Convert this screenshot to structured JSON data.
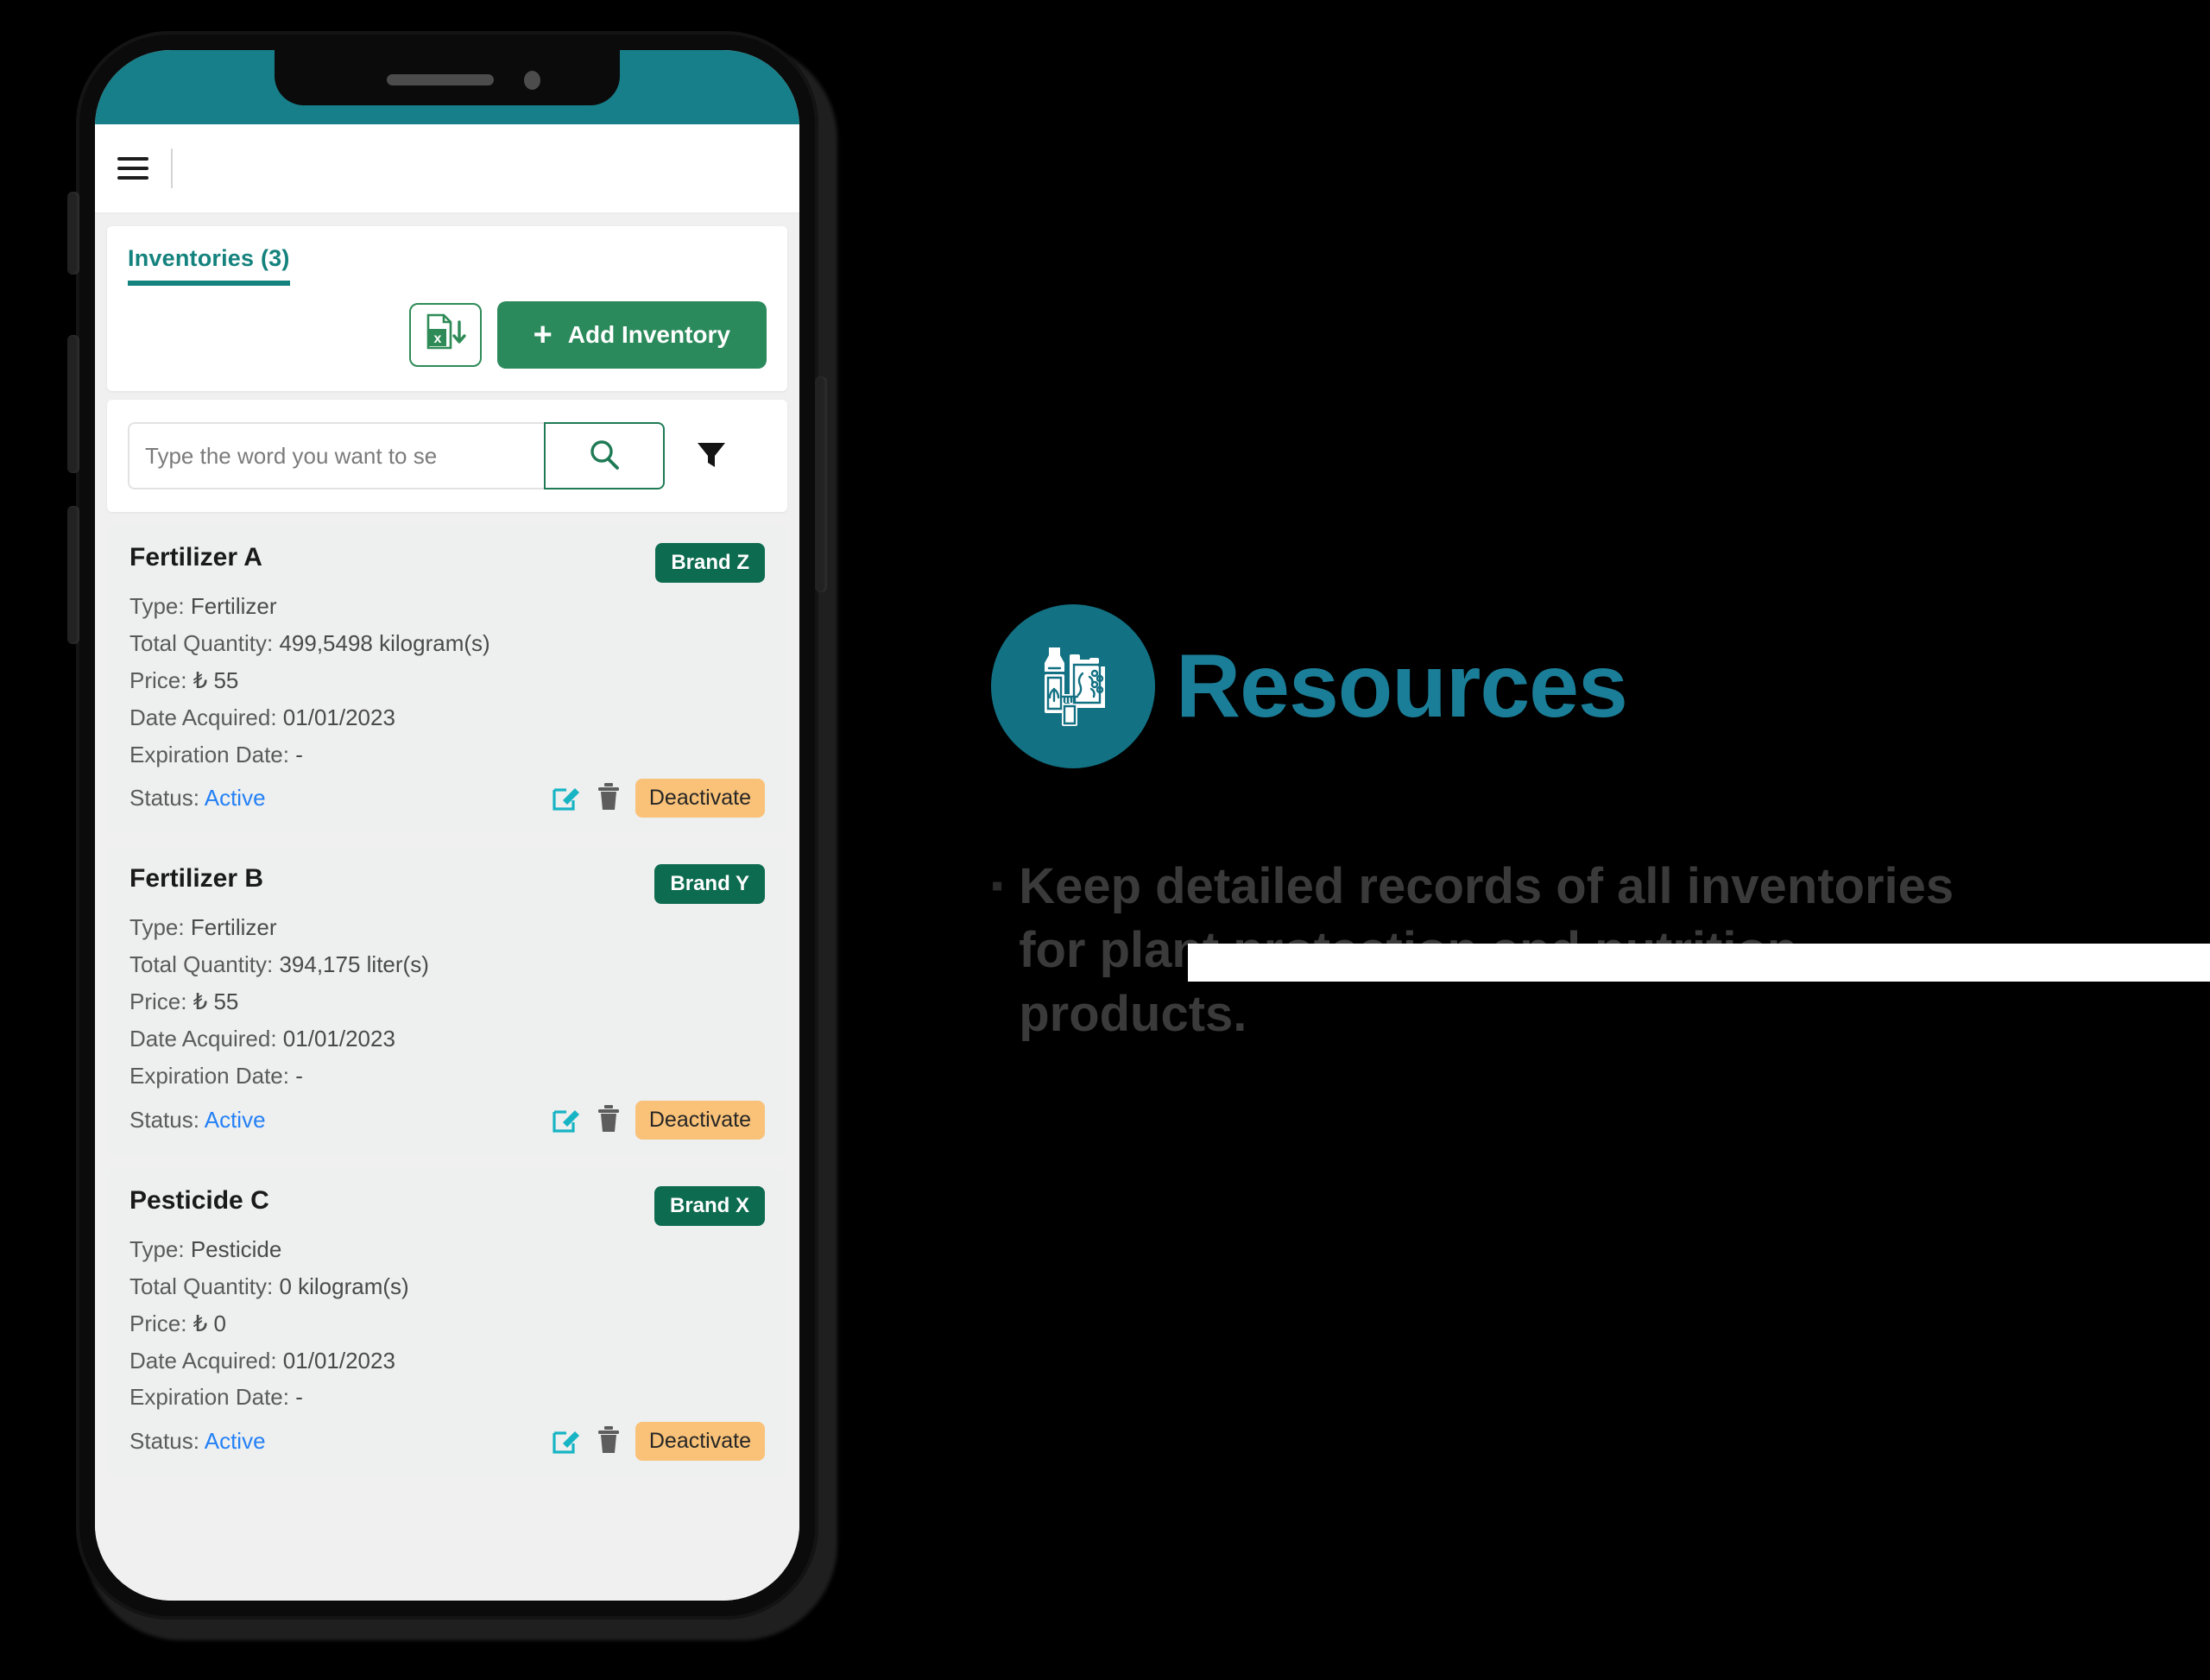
{
  "device": {
    "type": "smartphone-mockup",
    "status_bar_color": "#177f8a",
    "frame_color": "#0b0b0b",
    "buttons": [
      "silent-switch",
      "volume-up",
      "volume-down",
      "power-button"
    ]
  },
  "app": {
    "header": {
      "menu_icon": "hamburger-icon",
      "divider": true
    },
    "tab": {
      "label": "Inventories (3)",
      "accent_color": "#14827d"
    },
    "toolbar": {
      "export_icon": "excel-download-icon",
      "add_label": "Add Inventory",
      "add_plus": "+",
      "add_color": "#2b8a5c"
    },
    "search": {
      "placeholder": "Type the word you want to se",
      "value": "",
      "search_icon": "search-icon",
      "filter_icon": "filter-funnel-icon"
    },
    "labels": {
      "type": "Type:",
      "quantity": "Total Quantity:",
      "price": "Price:",
      "date_acquired": "Date Acquired:",
      "expiration": "Expiration Date:",
      "status": "Status:",
      "edit_icon": "edit-icon",
      "delete_icon": "trash-icon",
      "deactivate": "Deactivate"
    },
    "inventories": [
      {
        "name": "Fertilizer A",
        "brand": "Brand Z",
        "type": "Fertilizer",
        "quantity": "499,5498 kilogram(s)",
        "price": "₺ 55",
        "date_acquired": "01/01/2023",
        "expiration": "-",
        "status": "Active"
      },
      {
        "name": "Fertilizer B",
        "brand": "Brand Y",
        "type": "Fertilizer",
        "quantity": "394,175 liter(s)",
        "price": "₺ 55",
        "date_acquired": "01/01/2023",
        "expiration": "-",
        "status": "Active"
      },
      {
        "name": "Pesticide C",
        "brand": "Brand X",
        "type": "Pesticide",
        "quantity": "0 kilogram(s)",
        "price": "₺ 0",
        "date_acquired": "01/01/2023",
        "expiration": "-",
        "status": "Active"
      }
    ]
  },
  "resources": {
    "title": "Resources",
    "icon": "bottle-jerrycan-icon",
    "icon_bg": "#127183",
    "title_color": "#1b7e98",
    "bullet": "▪",
    "description": "Keep detailed records of all inventories for plant protection and nutrition products."
  }
}
